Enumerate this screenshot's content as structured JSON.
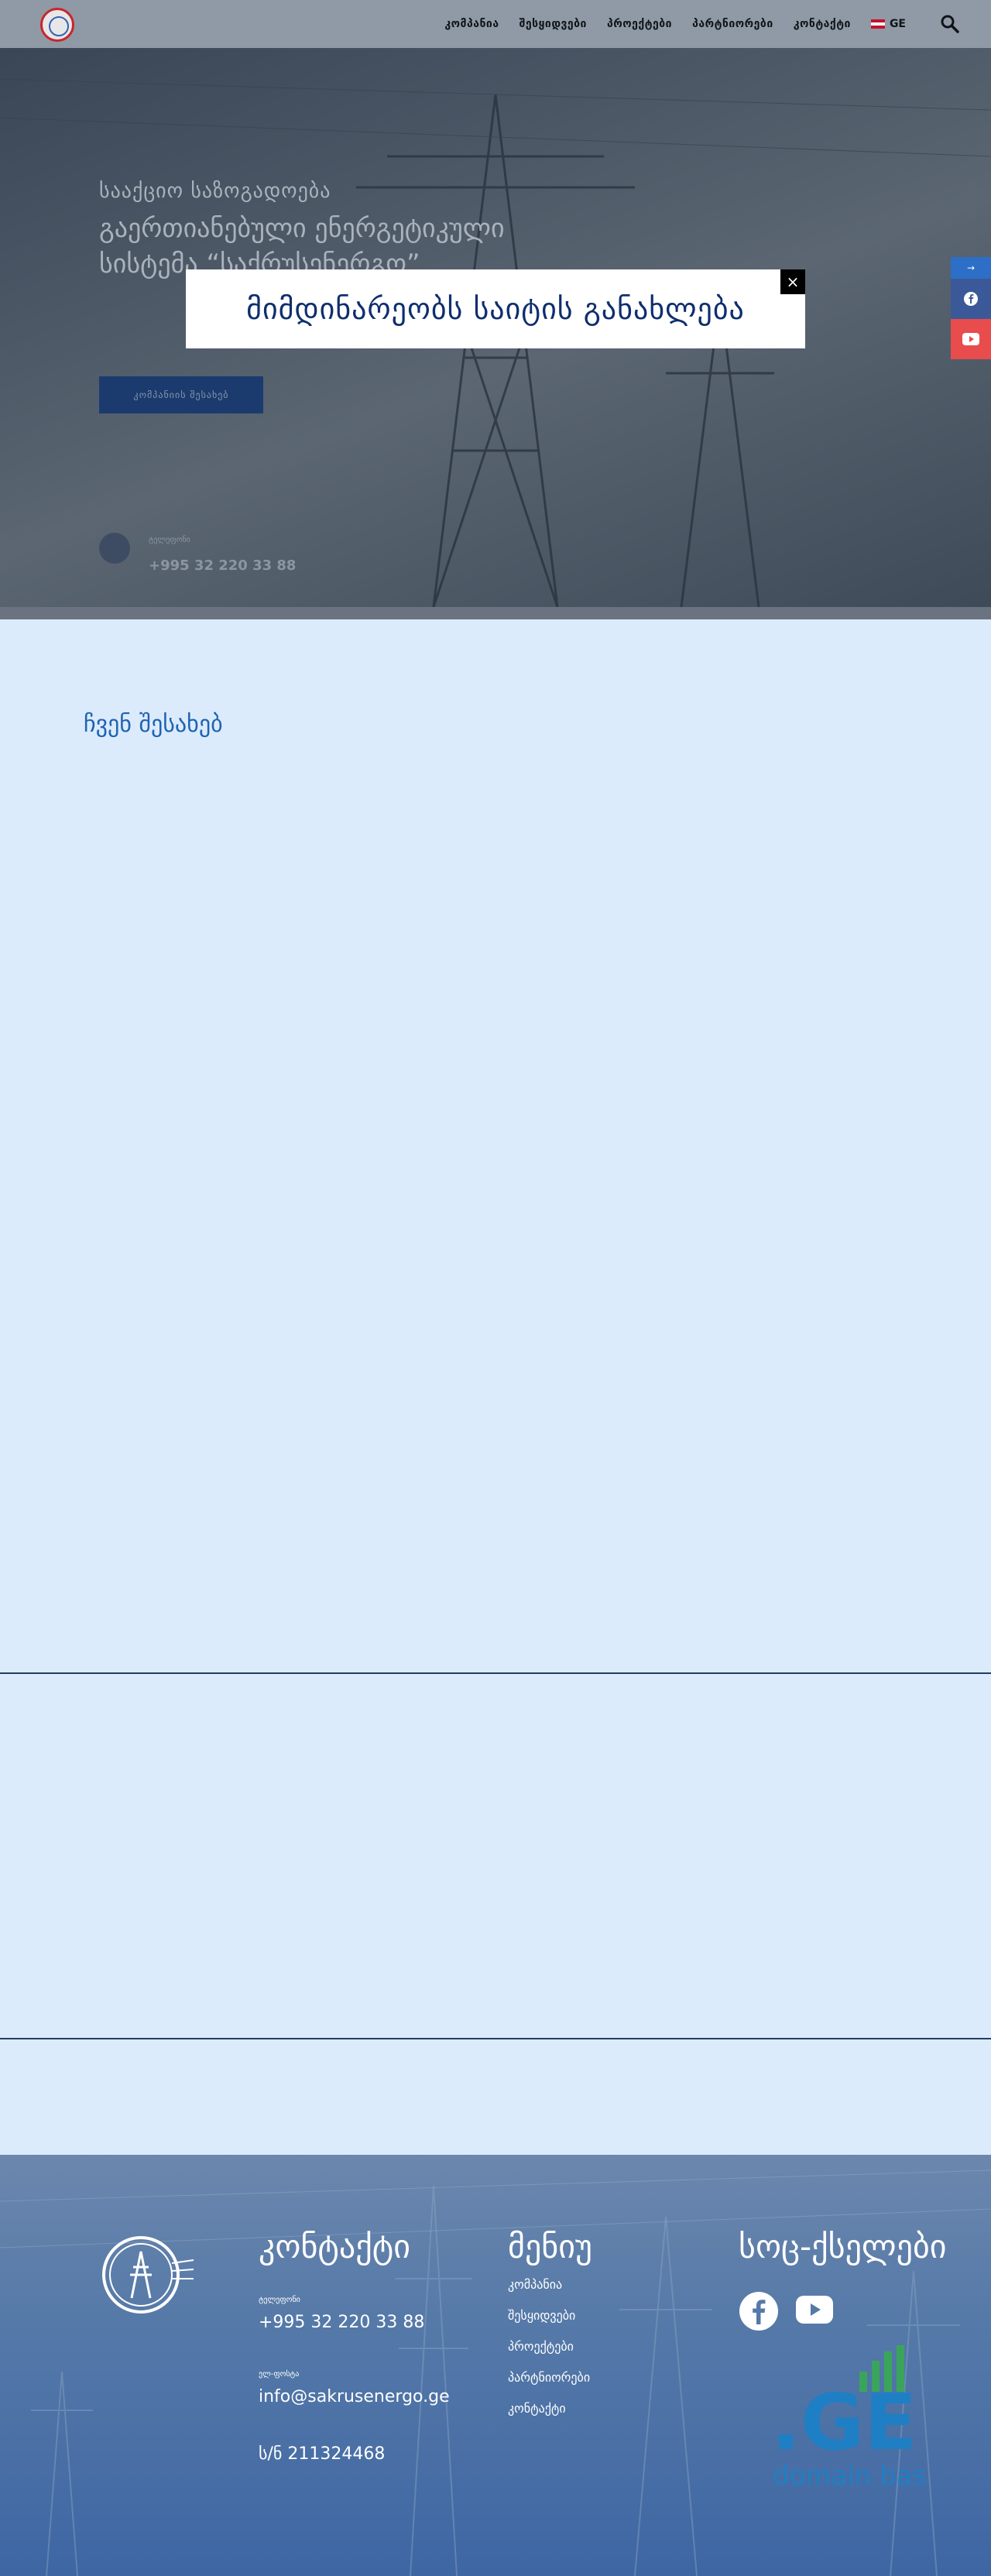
{
  "header": {
    "nav": [
      "კომპანია",
      "შესყიდვები",
      "პროექტები",
      "პარტნიორები",
      "კონტაქტი"
    ],
    "lang": "GE"
  },
  "hero": {
    "subtitle": "სააქციო საზოგადოება",
    "title": "გაერთიანებული ენერგეტიკული სისტემა “საქრუსენერგო”",
    "button": "კომპანიის შესახებ",
    "phone_label": "ტელეფონი",
    "phone": "+995 32 220 33 88"
  },
  "social_side": {
    "top": "→"
  },
  "modal": {
    "text": "მიმდინარეობს საიტის განახლება",
    "close": "×"
  },
  "about": {
    "title": "ჩვენ შესახებ"
  },
  "footer": {
    "contact_title": "კონტაქტი",
    "phone_label": "ტელეფონი",
    "phone": "+995 32 220 33 88",
    "email_label": "ელ-ფოსტა",
    "email": "info@sakrusenergo.ge",
    "code": "ს/ნ 211324468",
    "menu_title": "მენიუ",
    "menu": [
      "კომპანია",
      "შესყიდვები",
      "პროექტები",
      "პარტნიორები",
      "კონტაქტი"
    ],
    "social_title": "სოც-ქსელები",
    "domain_badge_top": ".GE",
    "domain_badge_bottom": "domain base"
  },
  "colors": {
    "accent": "#1f63b3",
    "modal_text": "#0e2e6e",
    "facebook": "#3b5998",
    "youtube": "#e84c4c"
  }
}
